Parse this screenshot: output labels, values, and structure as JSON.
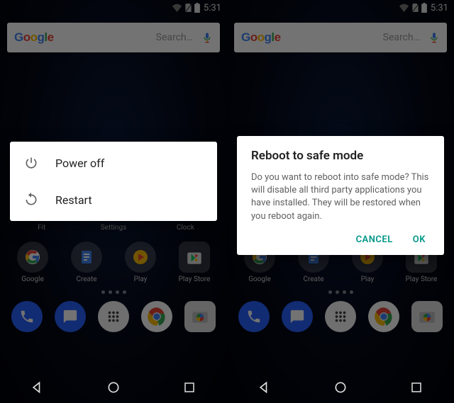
{
  "status": {
    "time": "5:31"
  },
  "search": {
    "placeholder": "Search…"
  },
  "apps_row1": [
    {
      "label": "Fit"
    },
    {
      "label": "Settings"
    },
    {
      "label": "Clock"
    }
  ],
  "apps_row2": [
    {
      "label": "Google"
    },
    {
      "label": "Create"
    },
    {
      "label": "Play"
    },
    {
      "label": "Play Store"
    }
  ],
  "apps_dock": [
    {
      "label": ""
    },
    {
      "label": ""
    },
    {
      "label": ""
    },
    {
      "label": ""
    },
    {
      "label": ""
    }
  ],
  "power_menu": {
    "power_off": "Power off",
    "restart": "Restart"
  },
  "safemode": {
    "title": "Reboot to safe mode",
    "body": "Do you want to reboot into safe mode? This will disable all third party applications you have installed. They will be restored when you reboot again.",
    "cancel": "CANCEL",
    "ok": "OK"
  }
}
